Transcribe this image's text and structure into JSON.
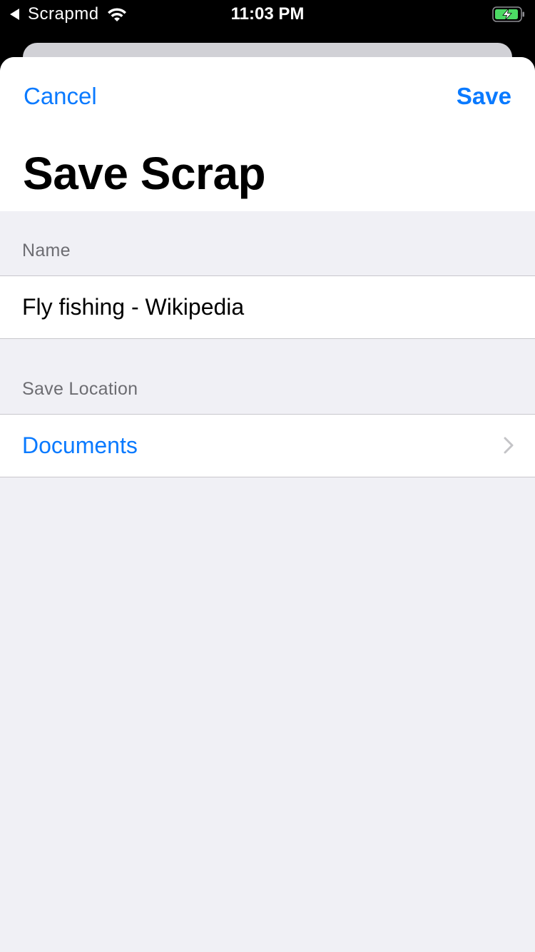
{
  "status_bar": {
    "back_app": "Scrapmd",
    "time": "11:03 PM",
    "icons": [
      "back-arrow-icon",
      "wifi-icon",
      "battery-charging-icon"
    ]
  },
  "nav": {
    "cancel_label": "Cancel",
    "save_label": "Save",
    "title": "Save Scrap"
  },
  "form": {
    "name_header": "Name",
    "name_value": "Fly fishing - Wikipedia",
    "location_header": "Save Location",
    "location_value": "Documents"
  },
  "colors": {
    "accent": "#0a7aff",
    "background": "#f0f0f5",
    "battery_green": "#4cd964"
  }
}
